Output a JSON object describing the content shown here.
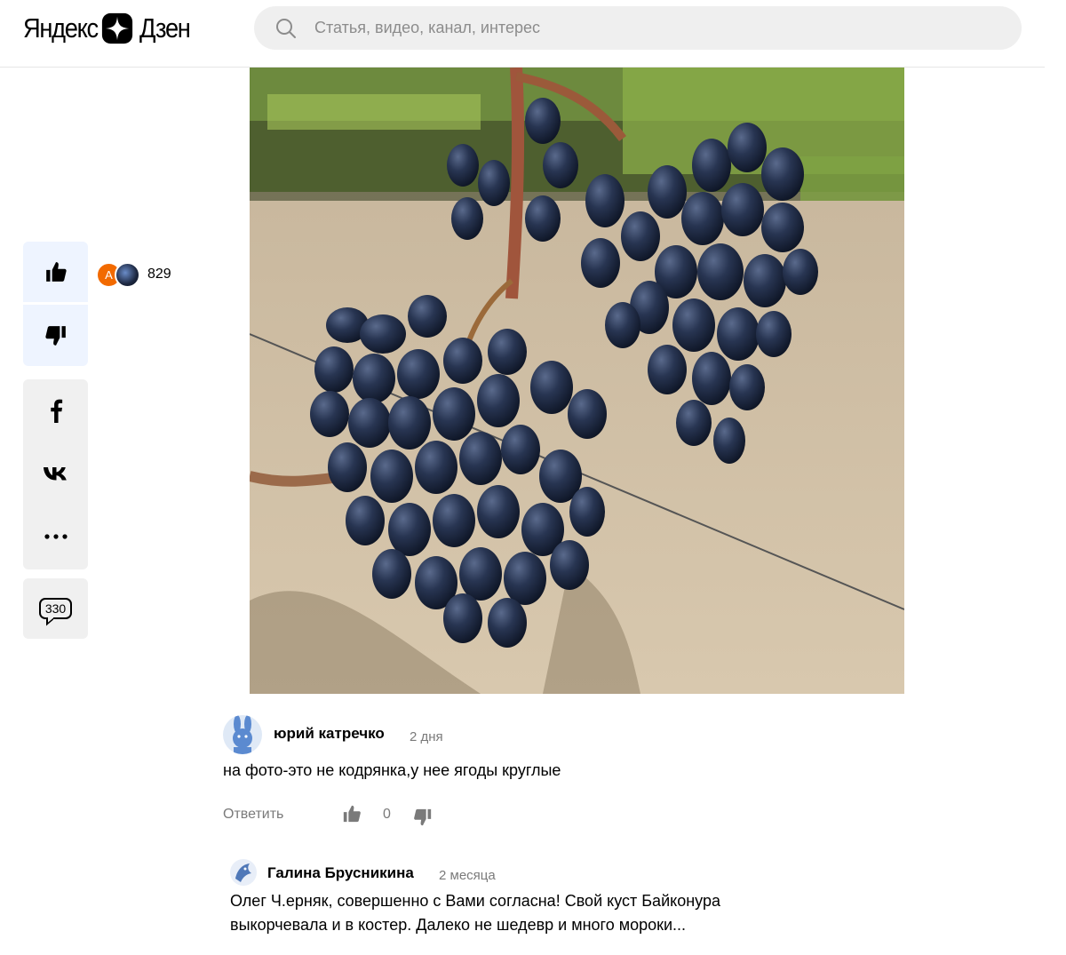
{
  "header": {
    "logo_left": "Яндекс",
    "logo_right": "Дзен",
    "search_placeholder": "Статья, видео, канал, интерес"
  },
  "actions": {
    "likes_count": "829",
    "liker_initial": "А",
    "comments_count": "330"
  },
  "icons": {
    "like": "thumb-up-icon",
    "dislike": "thumb-down-icon",
    "facebook": "facebook-icon",
    "vk": "vk-icon",
    "more": "more-icon",
    "search": "search-icon"
  },
  "comments": [
    {
      "author": "юрий катречко",
      "date": "2 дня",
      "text": "на фото-это не кодрянка,у нее ягоды круглые",
      "reply_label": "Ответить",
      "rating": "0"
    },
    {
      "author": "Галина Брусникина",
      "date": "2 месяца",
      "text": "Олег Ч.ерняк, совершенно с Вами согласна! Свой куст Байконура выкорчевала и в костер. Далеко не шедевр и много мороки..."
    }
  ],
  "colors": {
    "accent_panel": "#eef4ff",
    "neutral_panel": "#f0f0f0",
    "avatar_orange": "#f26a00"
  }
}
